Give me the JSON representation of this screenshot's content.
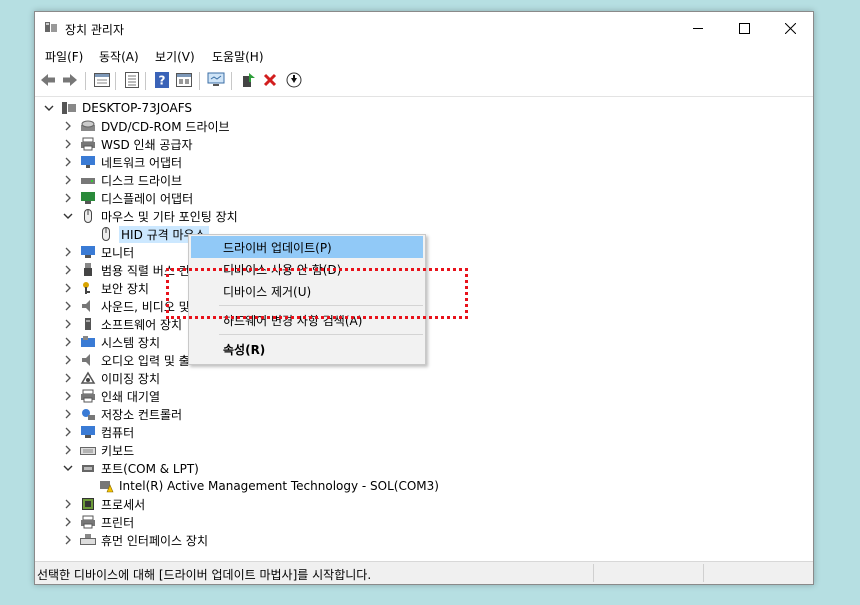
{
  "window": {
    "title": "장치 관리자",
    "controls": [
      "minimize",
      "maximize",
      "close"
    ]
  },
  "menubar": {
    "items": [
      "파일(F)",
      "동작(A)",
      "보기(V)",
      "도움말(H)"
    ]
  },
  "toolbar": {
    "icons": [
      "back-arrow-icon",
      "forward-arrow-icon",
      "properties-icon",
      "list-icon",
      "help-icon",
      "view-icon",
      "monitor-scan-icon",
      "update-driver-icon",
      "remove-icon",
      "download-icon"
    ]
  },
  "tree": {
    "root": "DESKTOP-73JOAFS",
    "items": [
      "DVD/CD-ROM 드라이브",
      "WSD 인쇄 공급자",
      "네트워크 어댑터",
      "디스크 드라이브",
      "디스플레이 어댑터",
      "마우스 및 기타 포인팅 장치",
      "HID 규격 마우스",
      "모니터",
      "범용 직렬 버스 컨",
      "보안 장치",
      "사운드, 비디오 및",
      "소프트웨어 장치",
      "시스템 장치",
      "오디오 입력 및 출",
      "이미징 장치",
      "인쇄 대기열",
      "저장소 컨트롤러",
      "컴퓨터",
      "키보드",
      "포트(COM & LPT)",
      "Intel(R) Active Management Technology - SOL(COM3)",
      "프로세서",
      "프린터",
      "휴먼 인터페이스 장치"
    ]
  },
  "context_menu": {
    "items": [
      "드라이버 업데이트(P)",
      "디바이스 사용 안 함(D)",
      "디바이스 제거(U)",
      "하드웨어 변경 사항 검색(A)",
      "속성(R)"
    ]
  },
  "statusbar": {
    "text": "선택한 디바이스에 대해 [드라이버 업데이트 마법사]를 시작합니다."
  },
  "colors": {
    "highlight_box": "#e8121b",
    "menu_highlight": "#91c9f7",
    "selection": "#cce8ff"
  }
}
